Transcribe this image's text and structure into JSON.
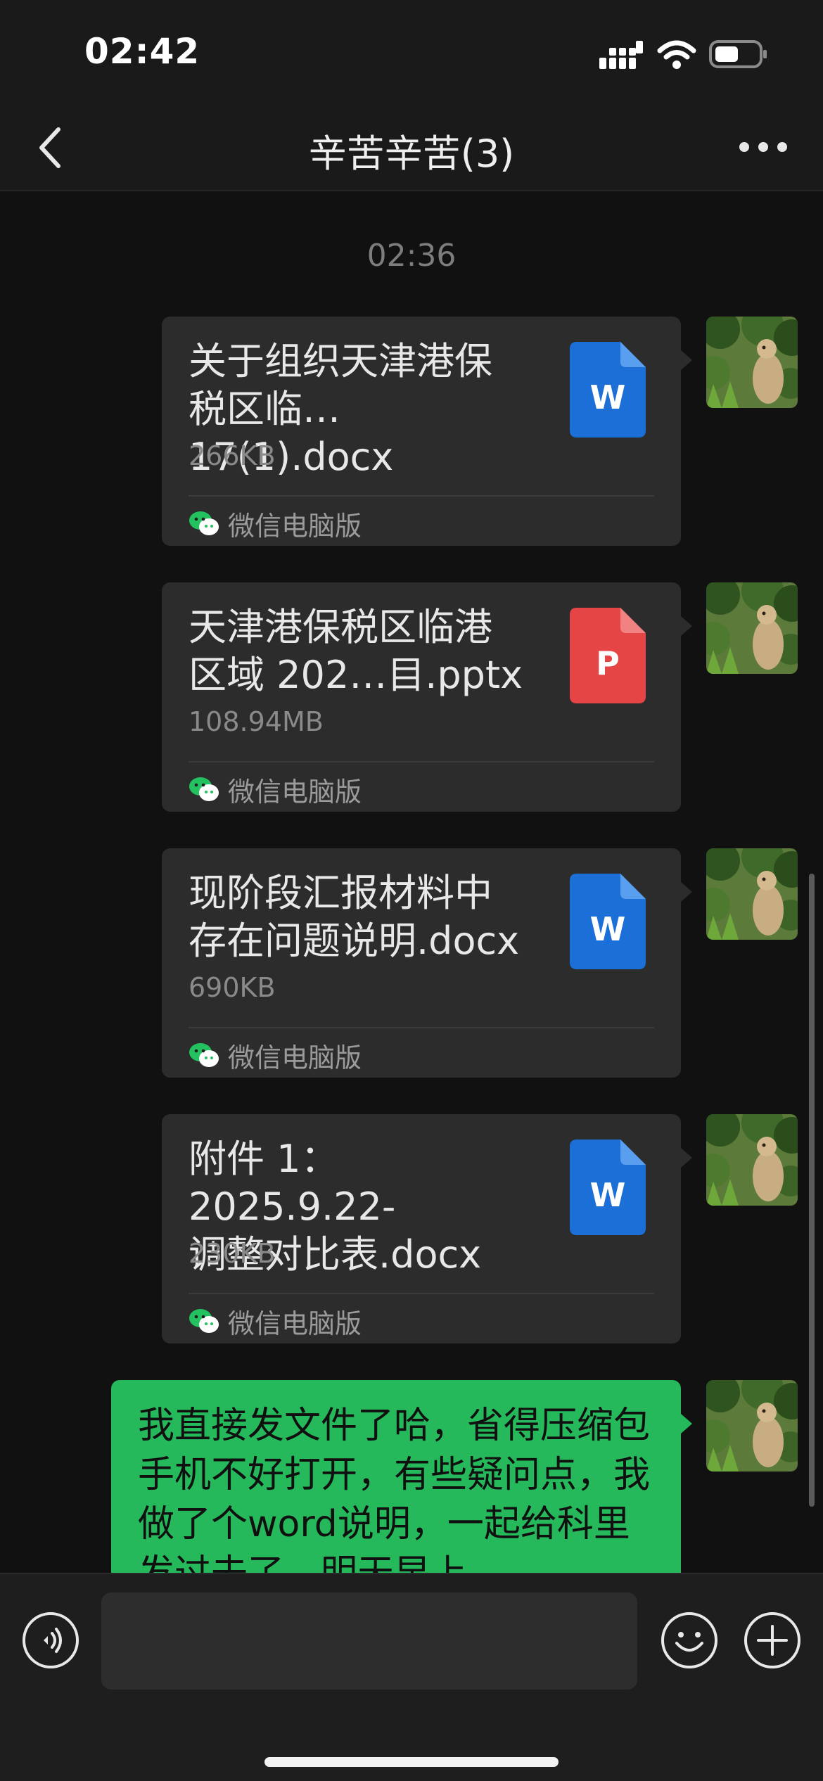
{
  "status_bar": {
    "time": "02:42"
  },
  "header": {
    "title": "辛苦辛苦(3)",
    "back_icon": "chevron-left-icon",
    "more_icon": "more-dots-icon"
  },
  "chat": {
    "timestamp": "02:36",
    "file_messages": [
      {
        "name": "关于组织天津港保\n税区临…17(1).docx",
        "size": "266KB",
        "source": "微信电脑版",
        "file_type": "W",
        "icon_color": "#1c6fd6"
      },
      {
        "name": "天津港保税区临港\n区域 202…目.pptx",
        "size": "108.94MB",
        "source": "微信电脑版",
        "file_type": "P",
        "icon_color": "#e54545"
      },
      {
        "name": "现阶段汇报材料中\n存在问题说明.docx",
        "size": "690KB",
        "source": "微信电脑版",
        "file_type": "W",
        "icon_color": "#1c6fd6"
      },
      {
        "name": "附件 1：2025.9.22-\n调整对比表.docx",
        "size": "230KB",
        "source": "微信电脑版",
        "file_type": "W",
        "icon_color": "#1c6fd6"
      }
    ],
    "text_message": "我直接发文件了哈，省得压缩包手机不好打开，有些疑问点，我做了个word说明，一起给科里发过去了，明天早上"
  },
  "input_bar": {
    "value": "",
    "voice_icon": "voice-icon",
    "emoji_icon": "emoji-icon",
    "add_icon": "plus-circle-icon"
  },
  "colors": {
    "sent_bubble": "#26b95c",
    "file_bubble": "#2c2c2c",
    "background": "#111111"
  }
}
